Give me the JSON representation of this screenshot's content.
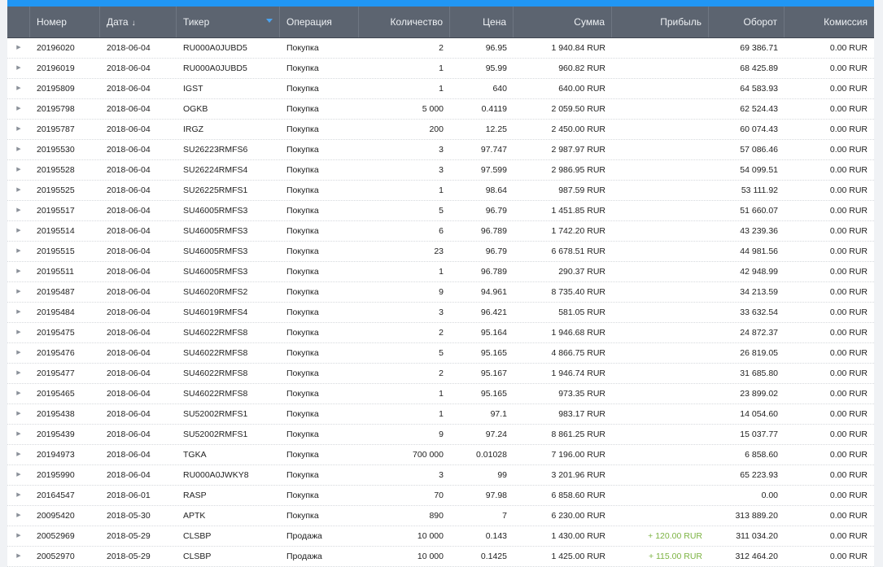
{
  "colors": {
    "topbar": "#2196f3",
    "header_bg": "#5c6470",
    "profit": "#7cb342"
  },
  "icons": {
    "sort": "sort-down-arrow-icon",
    "filter": "filter-triangle-icon",
    "expand": "expand-triangle-icon"
  },
  "columns": {
    "number": "Номер",
    "date": "Дата",
    "ticker": "Тикер",
    "operation": "Операция",
    "quantity": "Количество",
    "price": "Цена",
    "sum": "Сумма",
    "profit": "Прибыль",
    "turnover": "Оборот",
    "commission": "Комиссия"
  },
  "rows": [
    {
      "number": "20196020",
      "date": "2018-06-04",
      "ticker": "RU000A0JUBD5",
      "operation": "Покупка",
      "quantity": "2",
      "price": "96.95",
      "sum": "1 940.84 RUR",
      "profit": "",
      "turnover": "69 386.71",
      "commission": "0.00 RUR"
    },
    {
      "number": "20196019",
      "date": "2018-06-04",
      "ticker": "RU000A0JUBD5",
      "operation": "Покупка",
      "quantity": "1",
      "price": "95.99",
      "sum": "960.82 RUR",
      "profit": "",
      "turnover": "68 425.89",
      "commission": "0.00 RUR"
    },
    {
      "number": "20195809",
      "date": "2018-06-04",
      "ticker": "IGST",
      "operation": "Покупка",
      "quantity": "1",
      "price": "640",
      "sum": "640.00 RUR",
      "profit": "",
      "turnover": "64 583.93",
      "commission": "0.00 RUR"
    },
    {
      "number": "20195798",
      "date": "2018-06-04",
      "ticker": "OGKB",
      "operation": "Покупка",
      "quantity": "5 000",
      "price": "0.4119",
      "sum": "2 059.50 RUR",
      "profit": "",
      "turnover": "62 524.43",
      "commission": "0.00 RUR"
    },
    {
      "number": "20195787",
      "date": "2018-06-04",
      "ticker": "IRGZ",
      "operation": "Покупка",
      "quantity": "200",
      "price": "12.25",
      "sum": "2 450.00 RUR",
      "profit": "",
      "turnover": "60 074.43",
      "commission": "0.00 RUR"
    },
    {
      "number": "20195530",
      "date": "2018-06-04",
      "ticker": "SU26223RMFS6",
      "operation": "Покупка",
      "quantity": "3",
      "price": "97.747",
      "sum": "2 987.97 RUR",
      "profit": "",
      "turnover": "57 086.46",
      "commission": "0.00 RUR"
    },
    {
      "number": "20195528",
      "date": "2018-06-04",
      "ticker": "SU26224RMFS4",
      "operation": "Покупка",
      "quantity": "3",
      "price": "97.599",
      "sum": "2 986.95 RUR",
      "profit": "",
      "turnover": "54 099.51",
      "commission": "0.00 RUR"
    },
    {
      "number": "20195525",
      "date": "2018-06-04",
      "ticker": "SU26225RMFS1",
      "operation": "Покупка",
      "quantity": "1",
      "price": "98.64",
      "sum": "987.59 RUR",
      "profit": "",
      "turnover": "53 111.92",
      "commission": "0.00 RUR"
    },
    {
      "number": "20195517",
      "date": "2018-06-04",
      "ticker": "SU46005RMFS3",
      "operation": "Покупка",
      "quantity": "5",
      "price": "96.79",
      "sum": "1 451.85 RUR",
      "profit": "",
      "turnover": "51 660.07",
      "commission": "0.00 RUR"
    },
    {
      "number": "20195514",
      "date": "2018-06-04",
      "ticker": "SU46005RMFS3",
      "operation": "Покупка",
      "quantity": "6",
      "price": "96.789",
      "sum": "1 742.20 RUR",
      "profit": "",
      "turnover": "43 239.36",
      "commission": "0.00 RUR"
    },
    {
      "number": "20195515",
      "date": "2018-06-04",
      "ticker": "SU46005RMFS3",
      "operation": "Покупка",
      "quantity": "23",
      "price": "96.79",
      "sum": "6 678.51 RUR",
      "profit": "",
      "turnover": "44 981.56",
      "commission": "0.00 RUR"
    },
    {
      "number": "20195511",
      "date": "2018-06-04",
      "ticker": "SU46005RMFS3",
      "operation": "Покупка",
      "quantity": "1",
      "price": "96.789",
      "sum": "290.37 RUR",
      "profit": "",
      "turnover": "42 948.99",
      "commission": "0.00 RUR"
    },
    {
      "number": "20195487",
      "date": "2018-06-04",
      "ticker": "SU46020RMFS2",
      "operation": "Покупка",
      "quantity": "9",
      "price": "94.961",
      "sum": "8 735.40 RUR",
      "profit": "",
      "turnover": "34 213.59",
      "commission": "0.00 RUR"
    },
    {
      "number": "20195484",
      "date": "2018-06-04",
      "ticker": "SU46019RMFS4",
      "operation": "Покупка",
      "quantity": "3",
      "price": "96.421",
      "sum": "581.05 RUR",
      "profit": "",
      "turnover": "33 632.54",
      "commission": "0.00 RUR"
    },
    {
      "number": "20195475",
      "date": "2018-06-04",
      "ticker": "SU46022RMFS8",
      "operation": "Покупка",
      "quantity": "2",
      "price": "95.164",
      "sum": "1 946.68 RUR",
      "profit": "",
      "turnover": "24 872.37",
      "commission": "0.00 RUR"
    },
    {
      "number": "20195476",
      "date": "2018-06-04",
      "ticker": "SU46022RMFS8",
      "operation": "Покупка",
      "quantity": "5",
      "price": "95.165",
      "sum": "4 866.75 RUR",
      "profit": "",
      "turnover": "26 819.05",
      "commission": "0.00 RUR"
    },
    {
      "number": "20195477",
      "date": "2018-06-04",
      "ticker": "SU46022RMFS8",
      "operation": "Покупка",
      "quantity": "2",
      "price": "95.167",
      "sum": "1 946.74 RUR",
      "profit": "",
      "turnover": "31 685.80",
      "commission": "0.00 RUR"
    },
    {
      "number": "20195465",
      "date": "2018-06-04",
      "ticker": "SU46022RMFS8",
      "operation": "Покупка",
      "quantity": "1",
      "price": "95.165",
      "sum": "973.35 RUR",
      "profit": "",
      "turnover": "23 899.02",
      "commission": "0.00 RUR"
    },
    {
      "number": "20195438",
      "date": "2018-06-04",
      "ticker": "SU52002RMFS1",
      "operation": "Покупка",
      "quantity": "1",
      "price": "97.1",
      "sum": "983.17 RUR",
      "profit": "",
      "turnover": "14 054.60",
      "commission": "0.00 RUR"
    },
    {
      "number": "20195439",
      "date": "2018-06-04",
      "ticker": "SU52002RMFS1",
      "operation": "Покупка",
      "quantity": "9",
      "price": "97.24",
      "sum": "8 861.25 RUR",
      "profit": "",
      "turnover": "15 037.77",
      "commission": "0.00 RUR"
    },
    {
      "number": "20194973",
      "date": "2018-06-04",
      "ticker": "TGKA",
      "operation": "Покупка",
      "quantity": "700 000",
      "price": "0.01028",
      "sum": "7 196.00 RUR",
      "profit": "",
      "turnover": "6 858.60",
      "commission": "0.00 RUR"
    },
    {
      "number": "20195990",
      "date": "2018-06-04",
      "ticker": "RU000A0JWKY8",
      "operation": "Покупка",
      "quantity": "3",
      "price": "99",
      "sum": "3 201.96 RUR",
      "profit": "",
      "turnover": "65 223.93",
      "commission": "0.00 RUR"
    },
    {
      "number": "20164547",
      "date": "2018-06-01",
      "ticker": "RASP",
      "operation": "Покупка",
      "quantity": "70",
      "price": "97.98",
      "sum": "6 858.60 RUR",
      "profit": "",
      "turnover": "0.00",
      "commission": "0.00 RUR"
    },
    {
      "number": "20095420",
      "date": "2018-05-30",
      "ticker": "APTK",
      "operation": "Покупка",
      "quantity": "890",
      "price": "7",
      "sum": "6 230.00 RUR",
      "profit": "",
      "turnover": "313 889.20",
      "commission": "0.00 RUR"
    },
    {
      "number": "20052969",
      "date": "2018-05-29",
      "ticker": "CLSBP",
      "operation": "Продажа",
      "quantity": "10 000",
      "price": "0.143",
      "sum": "1 430.00 RUR",
      "profit": "+ 120.00 RUR",
      "turnover": "311 034.20",
      "commission": "0.00 RUR"
    },
    {
      "number": "20052970",
      "date": "2018-05-29",
      "ticker": "CLSBP",
      "operation": "Продажа",
      "quantity": "10 000",
      "price": "0.1425",
      "sum": "1 425.00 RUR",
      "profit": "+ 115.00 RUR",
      "turnover": "312 464.20",
      "commission": "0.00 RUR"
    }
  ]
}
